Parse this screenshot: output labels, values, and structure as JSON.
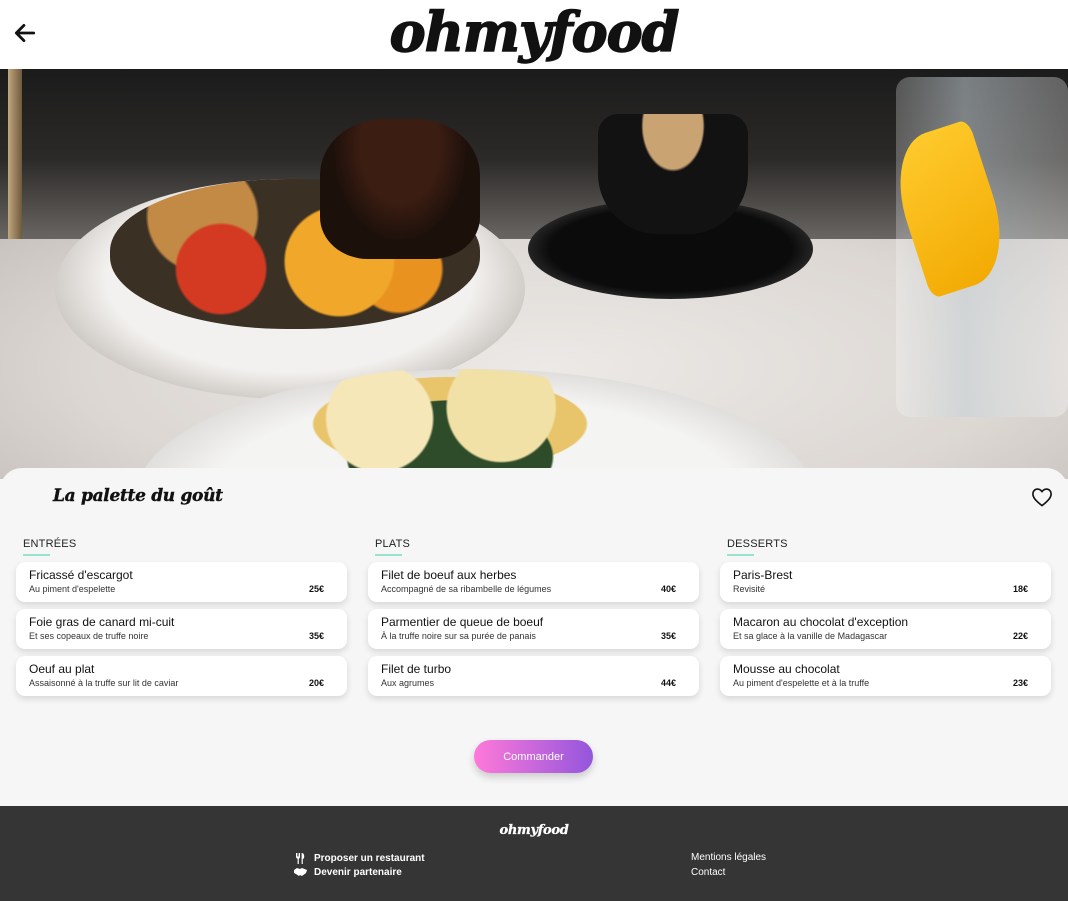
{
  "header": {
    "logo": "ohmyfood"
  },
  "restaurant": {
    "name": "La palette du goût"
  },
  "menu": {
    "columns": [
      {
        "title": "ENTRÉES",
        "dishes": [
          {
            "name": "Fricassé d'escargot",
            "desc": "Au piment d'espelette",
            "price": "25€"
          },
          {
            "name": "Foie gras de canard mi-cuit",
            "desc": "Et ses copeaux de truffe noire",
            "price": "35€"
          },
          {
            "name": "Oeuf au plat",
            "desc": "Assaisonné à la truffe sur lit de caviar",
            "price": "20€"
          }
        ]
      },
      {
        "title": "PLATS",
        "dishes": [
          {
            "name": "Filet de boeuf aux herbes",
            "desc": "Accompagné de sa ribambelle de légumes",
            "price": "40€"
          },
          {
            "name": "Parmentier de queue de boeuf",
            "desc": "À la truffe noire sur sa purée de panais",
            "price": "35€"
          },
          {
            "name": "Filet de turbo",
            "desc": "Aux agrumes",
            "price": "44€"
          }
        ]
      },
      {
        "title": "DESSERTS",
        "dishes": [
          {
            "name": "Paris-Brest",
            "desc": "Revisité",
            "price": "18€"
          },
          {
            "name": "Macaron au chocolat d'exception",
            "desc": "Et sa glace à la vanille de Madagascar",
            "price": "22€"
          },
          {
            "name": "Mousse au chocolat",
            "desc": "Au piment d'espelette et à la truffe",
            "price": "23€"
          }
        ]
      }
    ]
  },
  "order_button": "Commander",
  "footer": {
    "logo": "ohmyfood",
    "left_links": [
      {
        "label": "Proposer un restaurant",
        "icon": "utensils-icon"
      },
      {
        "label": "Devenir partenaire",
        "icon": "handshake-icon"
      }
    ],
    "right_links": [
      {
        "label": "Mentions légales"
      },
      {
        "label": "Contact"
      }
    ]
  },
  "colors": {
    "accent_underline": "#99e2d0",
    "button_gradient_start": "#ff79da",
    "button_gradient_end": "#9356dc",
    "footer_bg": "#353535"
  }
}
